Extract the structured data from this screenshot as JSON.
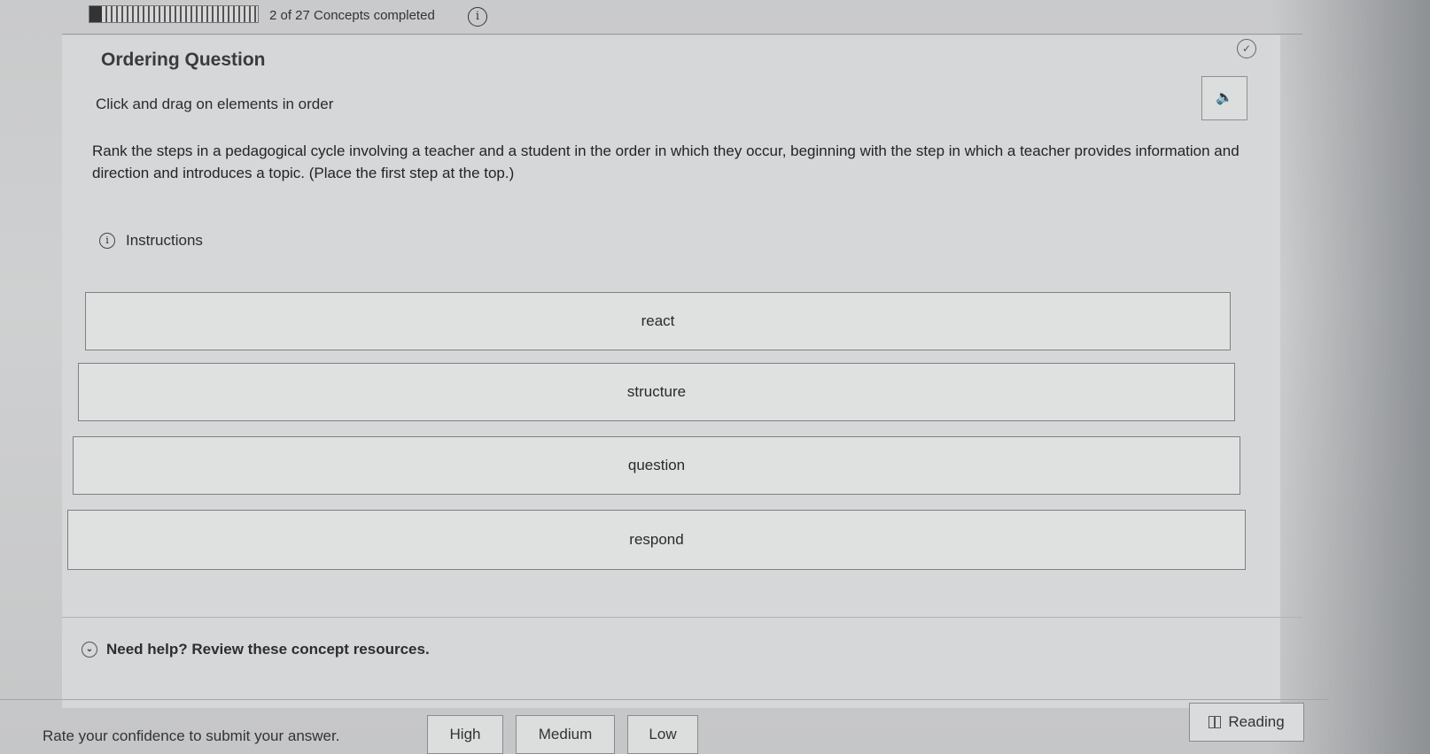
{
  "progress": {
    "completed": 2,
    "total": 27,
    "label": "2 of 27 Concepts completed"
  },
  "header": {
    "title": "Ordering Question"
  },
  "prompt": {
    "instruction": "Click and drag on elements in order",
    "question": "Rank the steps in a pedagogical cycle involving a teacher and a student in the order in which they occur, beginning with the step in which a teacher provides information and direction and introduces a topic. (Place the first step at the top.)",
    "instructions_link": "Instructions"
  },
  "items": [
    {
      "label": "react"
    },
    {
      "label": "structure"
    },
    {
      "label": "question"
    },
    {
      "label": "respond"
    }
  ],
  "help": {
    "label": "Need help? Review these concept resources."
  },
  "footer": {
    "rate_label": "Rate your confidence to submit your answer.",
    "confidence_options": [
      "High",
      "Medium",
      "Low"
    ],
    "reading_label": "Reading"
  },
  "icons": {
    "info": "info-icon",
    "check": "check-circle-icon",
    "audio": "speaker-icon",
    "chevron": "chevron-down-icon",
    "book": "book-icon"
  }
}
